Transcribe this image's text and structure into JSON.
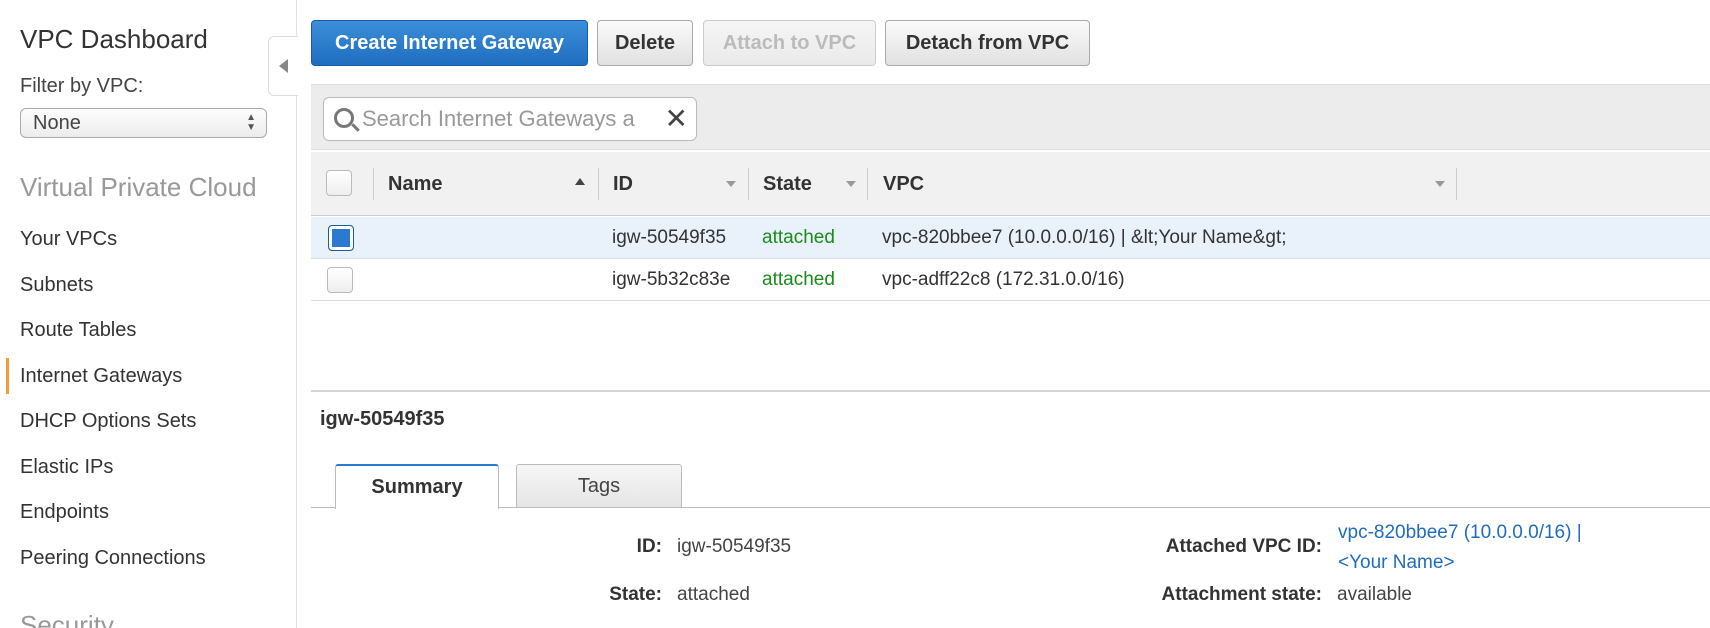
{
  "sidebar": {
    "title": "VPC Dashboard",
    "filter_label": "Filter by VPC:",
    "filter_value": "None",
    "section_vpc": "Virtual Private Cloud",
    "items": [
      "Your VPCs",
      "Subnets",
      "Route Tables",
      "Internet Gateways",
      "DHCP Options Sets",
      "Elastic IPs",
      "Endpoints",
      "Peering Connections"
    ],
    "active_item": "Internet Gateways",
    "section_security": "Security"
  },
  "toolbar": {
    "create_label": "Create Internet Gateway",
    "delete_label": "Delete",
    "attach_label": "Attach to VPC",
    "detach_label": "Detach from VPC"
  },
  "search": {
    "placeholder": "Search Internet Gateways a"
  },
  "table": {
    "columns": [
      "Name",
      "ID",
      "State",
      "VPC"
    ],
    "rows": [
      {
        "name": "",
        "id": "igw-50549f35",
        "state": "attached",
        "vpc": "vpc-820bbee7 (10.0.0.0/16) | &lt;Your Name&gt;",
        "selected": true
      },
      {
        "name": "",
        "id": "igw-5b32c83e",
        "state": "attached",
        "vpc": "vpc-adff22c8 (172.31.0.0/16)",
        "selected": false
      }
    ]
  },
  "detail": {
    "title": "igw-50549f35",
    "tabs": [
      "Summary",
      "Tags"
    ],
    "id_label": "ID:",
    "id_value": "igw-50549f35",
    "state_label": "State:",
    "state_value": "attached",
    "attached_vpc_label": "Attached VPC ID:",
    "attached_vpc_line1": "vpc-820bbee7 (10.0.0.0/16) |",
    "attached_vpc_line2": "<Your Name>",
    "attachment_state_label": "Attachment state:",
    "attachment_state_value": "available"
  },
  "colors": {
    "primary": "#1f6dc0",
    "status_green": "#1a8c1a",
    "active_nav": "#f0a030"
  }
}
